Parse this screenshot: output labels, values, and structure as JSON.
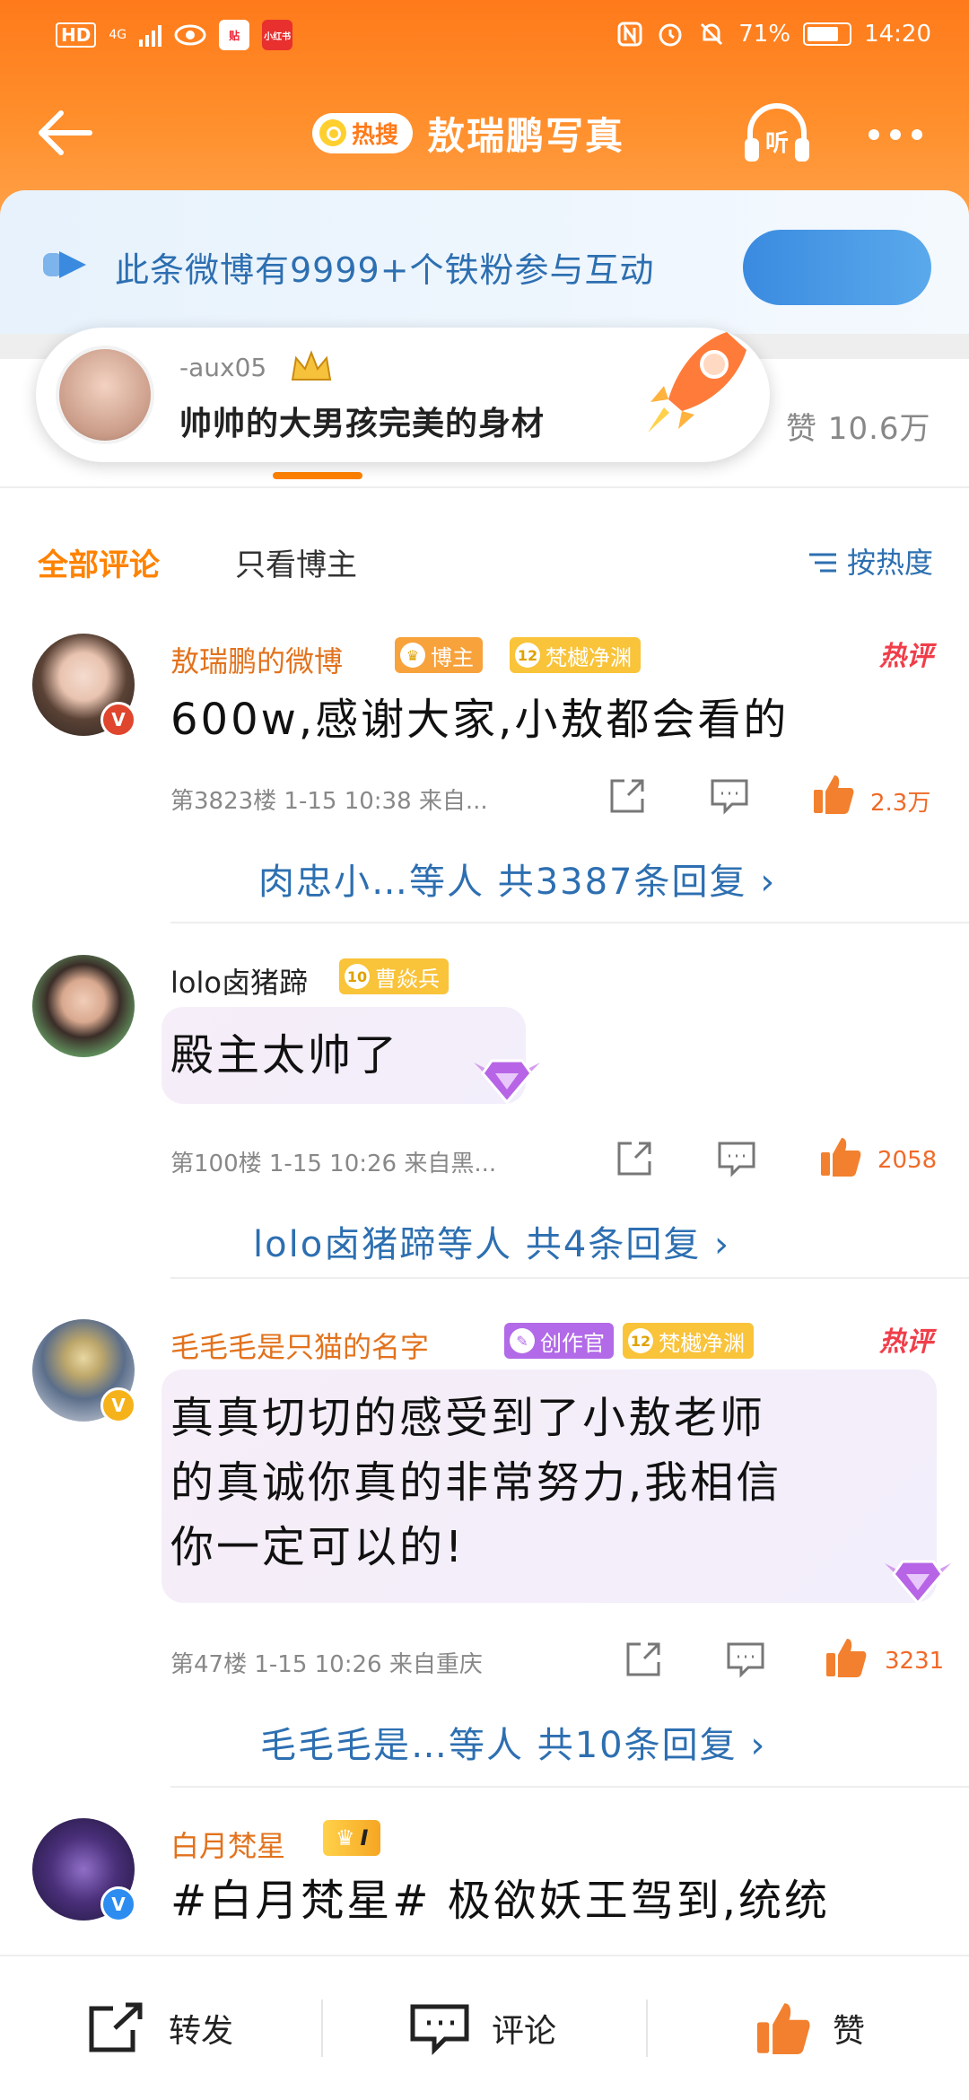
{
  "status_bar": {
    "net": "HD",
    "signal_type": "4G",
    "mini_app_1": "贴",
    "mini_app_2": "小红书",
    "battery": "71%",
    "time": "14:20"
  },
  "nav": {
    "hot_tag": "热搜",
    "title": "敖瑞鹏写真",
    "listen": "听"
  },
  "banner": {
    "text": "此条微博有9999+个铁粉参与互动"
  },
  "floating_comment": {
    "user": "-aux05",
    "text": "帅帅的大男孩完美的身材"
  },
  "likes_total": "赞 10.6万",
  "comment_header": {
    "all": "全部评论",
    "poster_only": "只看博主",
    "sort": "按热度"
  },
  "comments": [
    {
      "name": "敖瑞鹏的微博",
      "badge_poster": "博主",
      "fan_level": "12",
      "fan_group": "梵樾净渊",
      "hot": "热评",
      "text": "600w,感谢大家,小敖都会看的",
      "meta": "第3823楼 1-15 10:38  来自...",
      "likes": "2.3万",
      "replies": "肉忠小…等人  共3387条回复 ›"
    },
    {
      "name": "lolo卤猪蹄",
      "fan_level": "10",
      "fan_group": "曹焱兵",
      "text": "殿主太帅了",
      "meta": "第100楼 1-15 10:26  来自黑...",
      "likes": "2058",
      "replies": "lolo卤猪蹄等人  共4条回复 ›"
    },
    {
      "name": "毛毛毛是只猫的名字",
      "badge_creator": "创作官",
      "fan_level": "12",
      "fan_group": "梵樾净渊",
      "hot": "热评",
      "text_line1": "真真切切的感受到了小敖老师",
      "text_line2": "的真诚你真的非常努力,我相信",
      "text_line3": "你一定可以的!",
      "meta": "第47楼 1-15 10:26  来自重庆",
      "likes": "3231",
      "replies": "毛毛毛是…等人  共10条回复 ›"
    },
    {
      "name": "白月梵星",
      "member_level": "I",
      "text": "#白月梵星# 极欲妖王驾到,统统"
    }
  ],
  "bottom_bar": {
    "repost": "转发",
    "comment": "评论",
    "like": "赞"
  },
  "colors": {
    "brand_orange": "#ff8200",
    "link_blue": "#2d6fb1",
    "hot_red": "#f03e4a"
  }
}
